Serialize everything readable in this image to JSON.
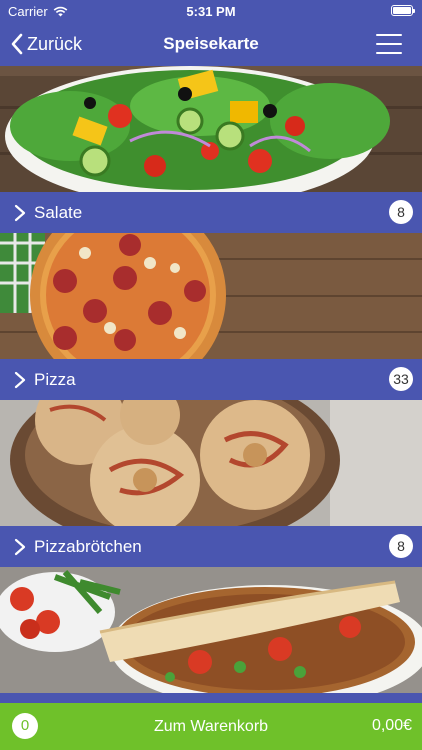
{
  "status_bar": {
    "carrier": "Carrier",
    "time": "5:31 PM"
  },
  "nav": {
    "back_label": "Zurück",
    "title": "Speisekarte"
  },
  "categories": [
    {
      "label": "Salate",
      "count": "8"
    },
    {
      "label": "Pizza",
      "count": "33"
    },
    {
      "label": "Pizzabrötchen",
      "count": "8"
    },
    {
      "label": "",
      "count": ""
    }
  ],
  "cart": {
    "quantity": "0",
    "label": "Zum Warenkorb",
    "total": "0,00€"
  },
  "colors": {
    "primary": "#4a56b0",
    "cart": "#6fc12a"
  },
  "icons": [
    "wifi-icon",
    "battery-icon",
    "back-chevron-icon",
    "hamburger-menu-icon",
    "chevron-right-icon"
  ]
}
